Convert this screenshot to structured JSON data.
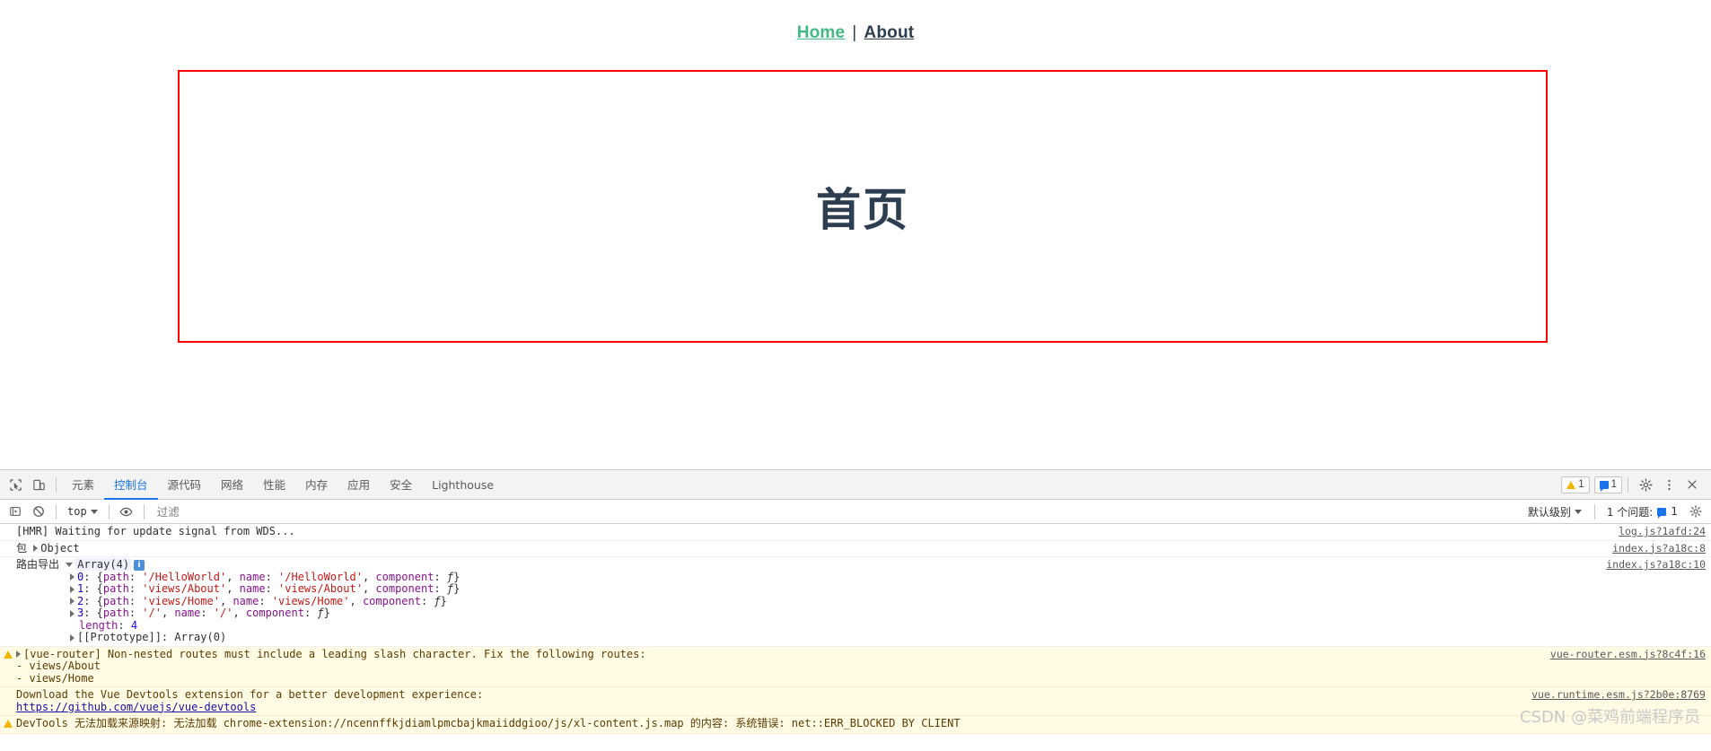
{
  "page": {
    "nav": {
      "home_label": "Home",
      "separator": "|",
      "about_label": "About",
      "active_color": "#42b983",
      "inactive_color": "#2c3e50"
    },
    "view": {
      "title": "首页",
      "border_color": "#ff0000"
    }
  },
  "devtools": {
    "tabs": [
      {
        "label": "元素",
        "active": false
      },
      {
        "label": "控制台",
        "active": true
      },
      {
        "label": "源代码",
        "active": false
      },
      {
        "label": "网络",
        "active": false
      },
      {
        "label": "性能",
        "active": false
      },
      {
        "label": "内存",
        "active": false
      },
      {
        "label": "应用",
        "active": false
      },
      {
        "label": "安全",
        "active": false
      },
      {
        "label": "Lighthouse",
        "active": false
      }
    ],
    "status": {
      "warning_count": "1",
      "message_count": "1"
    },
    "icons": {
      "inspect": "inspect-element-icon",
      "device": "device-toolbar-icon",
      "settings": "gear-icon",
      "more": "kebab-menu-icon",
      "close": "close-icon"
    },
    "filter_bar": {
      "execute_label": "execute-sidebar-icon",
      "clear_label": "clear-console-icon",
      "context": "top",
      "eye_label": "live-expression-icon",
      "filter_placeholder": "过滤",
      "filter_value": "",
      "level": "默认级别",
      "issues_label": "1 个问题:",
      "issues_count": "1"
    },
    "console": {
      "rows": [
        {
          "type": "log",
          "text": "[HMR] Waiting for update signal from WDS...",
          "source": "log.js?1afd:24"
        },
        {
          "type": "object",
          "label": "包",
          "text": "Object",
          "source": "index.js?a18c:8"
        },
        {
          "type": "array",
          "label": "路由导出",
          "text": "Array(4)",
          "source": "index.js?a18c:10",
          "entries": [
            {
              "index": "0",
              "path": "'/HelloWorld'",
              "name": "'/HelloWorld'"
            },
            {
              "index": "1",
              "path": "'views/About'",
              "name": "'views/About'"
            },
            {
              "index": "2",
              "path": "'views/Home'",
              "name": "'views/Home'"
            },
            {
              "index": "3",
              "path": "'/'",
              "name": "'/'"
            }
          ],
          "length_key": "length",
          "length_value": "4",
          "prototype": "[[Prototype]]: Array(0)"
        },
        {
          "type": "warning",
          "text": "[vue-router] Non-nested routes must include a leading slash character. Fix the following routes:\n- views/About\n- views/Home",
          "source": "vue-router.esm.js?8c4f:16"
        },
        {
          "type": "warning-plain",
          "text": "Download the Vue Devtools extension for a better development experience:",
          "link": "https://github.com/vuejs/vue-devtools",
          "source": "vue.runtime.esm.js?2b0e:8769"
        },
        {
          "type": "warning",
          "text": "DevTools 无法加载来源映射: 无法加载 chrome-extension://ncennffkjdiamlpmcbajkmaiiddgioo/js/xl-content.js.map 的内容: 系统错误: net::ERR_BLOCKED BY CLIENT",
          "source": ""
        }
      ]
    }
  },
  "watermark": "CSDN @菜鸡前端程序员"
}
